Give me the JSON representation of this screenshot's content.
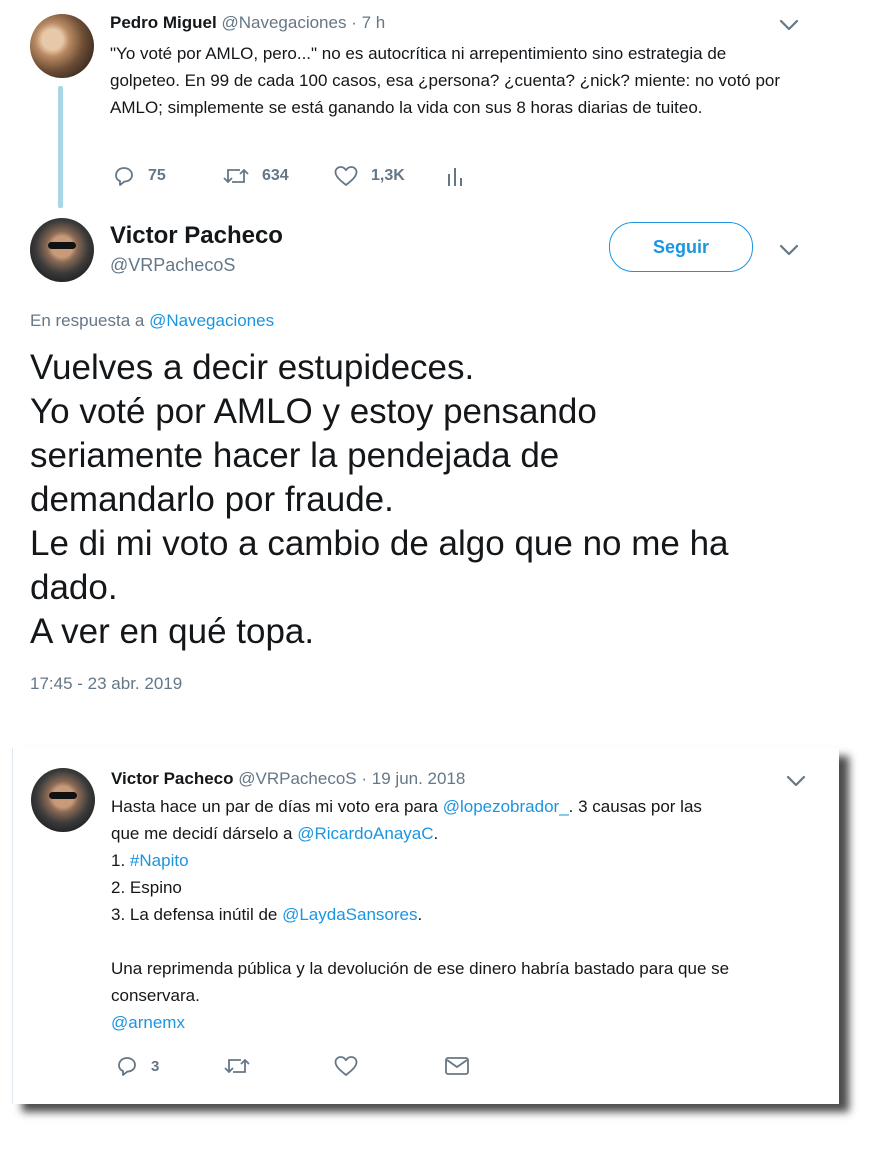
{
  "tweet1": {
    "author_name": "Pedro Miguel",
    "author_handle": "@Navegaciones",
    "separator": "·",
    "time": "7 h",
    "text": "\"Yo voté por AMLO, pero...\" no es autocrítica ni arrepentimiento sino estrategia de golpeteo. En 99 de cada 100 casos, esa ¿persona? ¿cuenta? ¿nick? miente: no votó por AMLO; simplemente se está ganando la vida con sus 8 horas diarias de tuiteo.",
    "replies": "75",
    "retweets": "634",
    "likes": "1,3K"
  },
  "tweet2": {
    "author_name": "Victor Pacheco",
    "author_handle": "@VRPachecoS",
    "follow_label": "Seguir",
    "reply_prefix": "En respuesta a",
    "reply_to": "@Navegaciones",
    "lines": [
      "Vuelves a decir estupideces.",
      "Yo voté por AMLO y estoy pensando",
      "seriamente hacer la pendejada de",
      "demandarlo por fraude.",
      "Le di mi voto a cambio de algo que no me ha",
      "dado.",
      "A ver en qué topa."
    ],
    "timestamp": "17:45 - 23 abr. 2019"
  },
  "tweet3": {
    "author_name": "Victor Pacheco",
    "author_handle": "@VRPachecoS",
    "separator": "·",
    "date": "19 jun. 2018",
    "line1_a": "Hasta hace un par de días mi voto era para",
    "mention1": "@lopezobrador_",
    "line1_b": ".  3 causas por las",
    "line2_a": "que me decidí dárselo a",
    "mention2": "@RicardoAnayaC",
    "line2_b": ".",
    "item1_num": "1.",
    "item1_tag": "#Napito",
    "item2": "2. Espino",
    "item3_a": "3. La defensa inútil de",
    "mention3": "@LaydaSansores",
    "item3_b": ".",
    "para2": "Una reprimenda pública y la devolución de ese dinero habría bastado para que se conservara.",
    "mention4": "@arnemx",
    "replies": "3"
  }
}
